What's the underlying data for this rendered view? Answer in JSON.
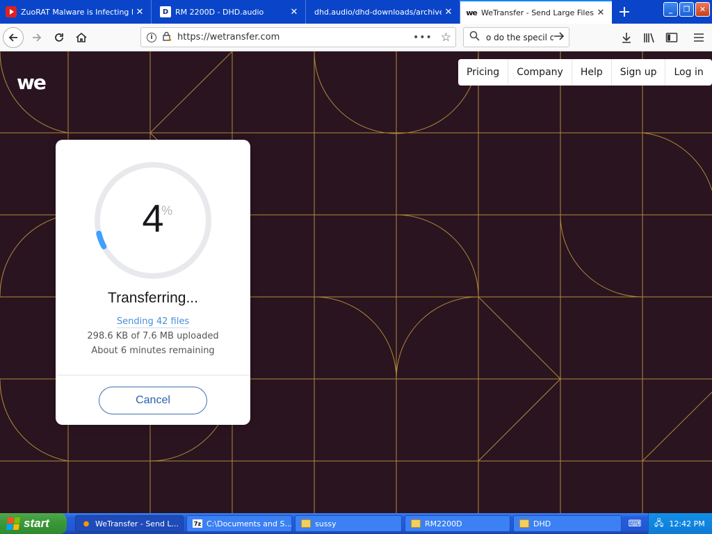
{
  "browser": {
    "tabs": [
      {
        "title": "ZuoRAT Malware is Infecting Rou",
        "favicon": "youtube-icon"
      },
      {
        "title": "RM 2200D - DHD.audio",
        "favicon": "dhd-icon"
      },
      {
        "title": "dhd.audio/dhd-downloads/archive/dh",
        "favicon": "none"
      },
      {
        "title": "WeTransfer - Send Large Files & S",
        "favicon": "wetransfer-icon"
      }
    ],
    "new_tab": "+",
    "url": "https://wetransfer.com",
    "search_value": "o do the specil d",
    "window_buttons": {
      "minimize": "_",
      "restore": "❐",
      "close": "✕"
    }
  },
  "page": {
    "logo": "we",
    "nav": [
      "Pricing",
      "Company",
      "Help",
      "Sign up",
      "Log in"
    ],
    "transfer": {
      "percent": "4",
      "percent_sign": "%",
      "progress_fraction": 0.04,
      "status": "Transferring...",
      "sending": "Sending 42 files",
      "uploaded": "298.6 KB of 7.6 MB uploaded",
      "remaining": "About 6 minutes remaining",
      "cancel": "Cancel"
    },
    "colors": {
      "background": "#2a1420",
      "pattern_line": "#b08a3a",
      "accent": "#4a8fd8"
    }
  },
  "taskbar": {
    "start": "start",
    "tasks": [
      {
        "label": "WeTransfer - Send L...",
        "icon": "firefox-icon"
      },
      {
        "label": "C:\\Documents and S...",
        "icon": "7zip-icon"
      },
      {
        "label": "sussy",
        "icon": "folder-icon"
      },
      {
        "label": "RM2200D",
        "icon": "folder-icon"
      },
      {
        "label": "DHD",
        "icon": "folder-icon"
      }
    ],
    "clock": "12:42 PM"
  }
}
